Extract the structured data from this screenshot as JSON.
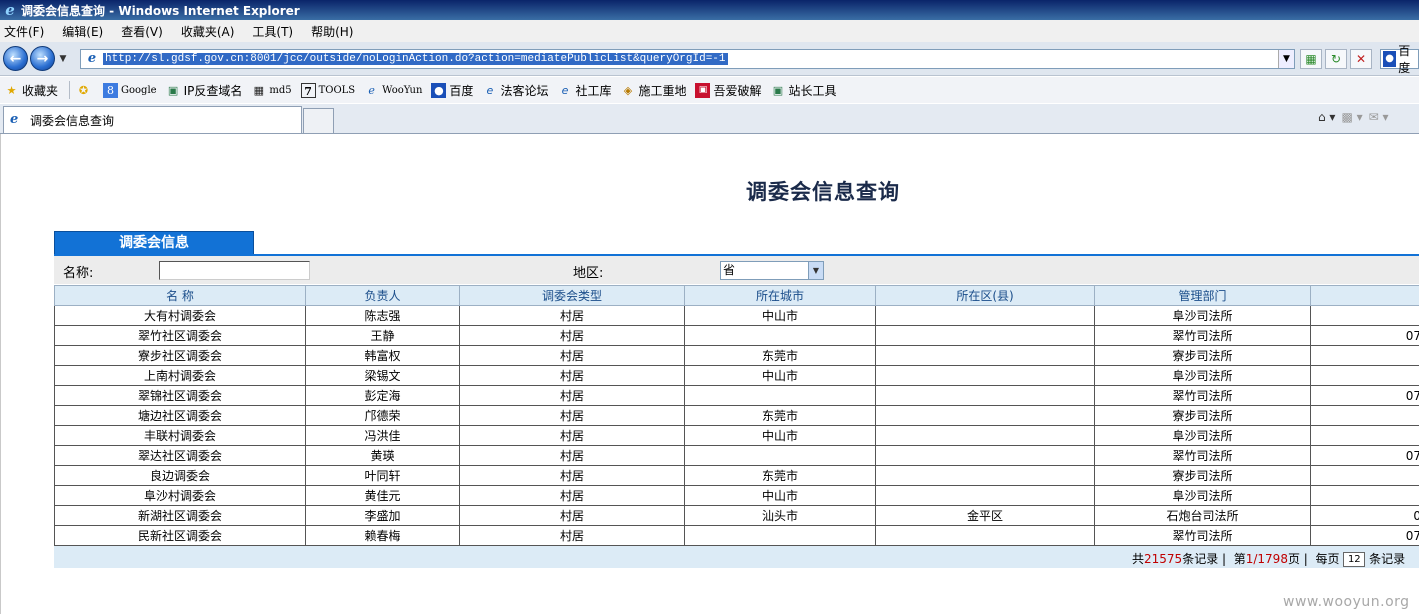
{
  "window": {
    "title": "调委会信息查询 - Windows Internet Explorer"
  },
  "menu": [
    "文件(F)",
    "编辑(E)",
    "查看(V)",
    "收藏夹(A)",
    "工具(T)",
    "帮助(H)"
  ],
  "address": {
    "url": "http://sl.gdsf.gov.cn:8001/jcc/outside/noLoginAction.do?action=mediatePublicList&queryOrgId=-1"
  },
  "search": {
    "label": "百度"
  },
  "favorites": {
    "label": "收藏夹",
    "items": [
      "Google",
      "IP反查域名",
      "md5",
      "TOOLS",
      "WooYun",
      "百度",
      "法客论坛",
      "社工库",
      "施工重地",
      "吾爱破解",
      "站长工具"
    ]
  },
  "tab": {
    "title": "调委会信息查询"
  },
  "page": {
    "title": "调委会信息查询",
    "section_tab": "调委会信息",
    "filter": {
      "name_label": "名称:",
      "name_value": "",
      "region_label": "地区:",
      "region_value": "省"
    },
    "table": {
      "headers": [
        "名 称",
        "负责人",
        "调委会类型",
        "所在城市",
        "所在区(县)",
        "管理部门",
        ""
      ],
      "rows": [
        [
          "大有村调委会",
          "陈志强",
          "村居",
          "中山市",
          "",
          "阜沙司法所",
          ""
        ],
        [
          "翠竹社区调委会",
          "王静",
          "村居",
          "",
          "",
          "翠竹司法所",
          "07"
        ],
        [
          "寮步社区调委会",
          "韩富权",
          "村居",
          "东莞市",
          "",
          "寮步司法所",
          ""
        ],
        [
          "上南村调委会",
          "梁锡文",
          "村居",
          "中山市",
          "",
          "阜沙司法所",
          ""
        ],
        [
          "翠锦社区调委会",
          "彭定海",
          "村居",
          "",
          "",
          "翠竹司法所",
          "07"
        ],
        [
          "塘边社区调委会",
          "邝德荣",
          "村居",
          "东莞市",
          "",
          "寮步司法所",
          ""
        ],
        [
          "丰联村调委会",
          "冯洪佳",
          "村居",
          "中山市",
          "",
          "阜沙司法所",
          ""
        ],
        [
          "翠达社区调委会",
          "黄瑛",
          "村居",
          "",
          "",
          "翠竹司法所",
          "07"
        ],
        [
          "良边调委会",
          "叶同轩",
          "村居",
          "东莞市",
          "",
          "寮步司法所",
          ""
        ],
        [
          "阜沙村调委会",
          "黄佳元",
          "村居",
          "中山市",
          "",
          "阜沙司法所",
          ""
        ],
        [
          "新湖社区调委会",
          "李盛加",
          "村居",
          "汕头市",
          "金平区",
          "石炮台司法所",
          "0"
        ],
        [
          "民新社区调委会",
          "赖春梅",
          "村居",
          "",
          "",
          "翠竹司法所",
          "07"
        ]
      ]
    },
    "pager": {
      "total_prefix": "共",
      "total": "21575",
      "total_suffix": "条记录",
      "page_prefix": "第",
      "page": "1/1798",
      "page_suffix": "页",
      "per_page_prefix": "每页",
      "per_page": "12",
      "per_page_suffix": "条记录"
    }
  },
  "watermark": "www.wooyun.org"
}
